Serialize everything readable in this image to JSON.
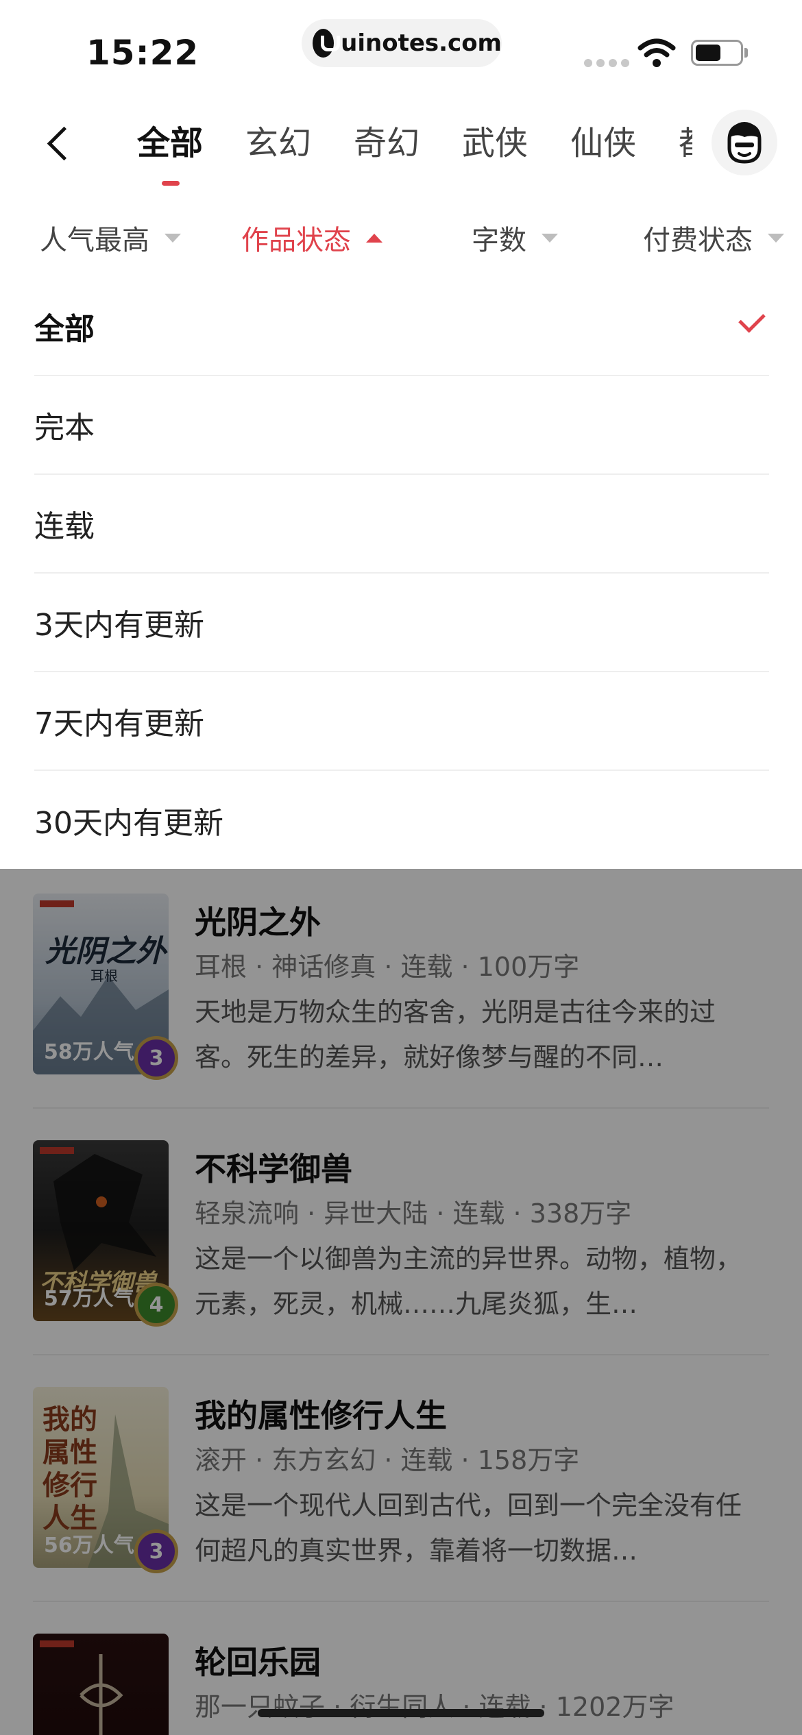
{
  "status_bar": {
    "time": "15:22",
    "url": "uinotes.com",
    "icons": [
      "signal-dots-icon",
      "wifi-icon",
      "battery-icon"
    ]
  },
  "nav": {
    "tabs": [
      {
        "label": "全部",
        "active": true
      },
      {
        "label": "玄幻",
        "active": false
      },
      {
        "label": "奇幻",
        "active": false
      },
      {
        "label": "武侠",
        "active": false
      },
      {
        "label": "仙侠",
        "active": false
      },
      {
        "label": "都",
        "active": false
      }
    ],
    "accent_color": "#e0434c"
  },
  "filters": [
    {
      "label": "人气最高",
      "active": false
    },
    {
      "label": "作品状态",
      "active": true
    },
    {
      "label": "字数",
      "active": false
    },
    {
      "label": "付费状态",
      "active": false
    }
  ],
  "status_options": [
    {
      "label": "全部",
      "selected": true
    },
    {
      "label": "完本",
      "selected": false
    },
    {
      "label": "连载",
      "selected": false
    },
    {
      "label": "3天内有更新",
      "selected": false
    },
    {
      "label": "7天内有更新",
      "selected": false
    },
    {
      "label": "30天内有更新",
      "selected": false
    }
  ],
  "books": [
    {
      "title": "光阴之外",
      "meta": "耳根 · 神话修真 · 连载 · 100万字",
      "desc": "天地是万物众生的客舍，光阴是古往今来的过客。死生的差异，就好像梦与醒的不同…",
      "popularity": "58万人气",
      "rank": "3",
      "cover_title": "光阴之外",
      "cover_author": "耳根"
    },
    {
      "title": "不科学御兽",
      "meta": "轻泉流响 · 异世大陆 · 连载 · 338万字",
      "desc": "这是一个以御兽为主流的异世界。动物，植物，元素，死灵，机械……九尾炎狐，生…",
      "popularity": "57万人气",
      "rank": "4",
      "cover_title": "不科学御兽"
    },
    {
      "title": "我的属性修行人生",
      "meta": "滚开 · 东方玄幻 · 连载 · 158万字",
      "desc": "这是一个现代人回到古代，回到一个完全没有任何超凡的真实世界，靠着将一切数据…",
      "popularity": "56万人气",
      "rank": "3",
      "cover_title": "我的属性修行人生"
    },
    {
      "title": "轮回乐园",
      "meta": "那一只蚊子 · 衍生同人 · 连载 · 1202万字"
    }
  ]
}
